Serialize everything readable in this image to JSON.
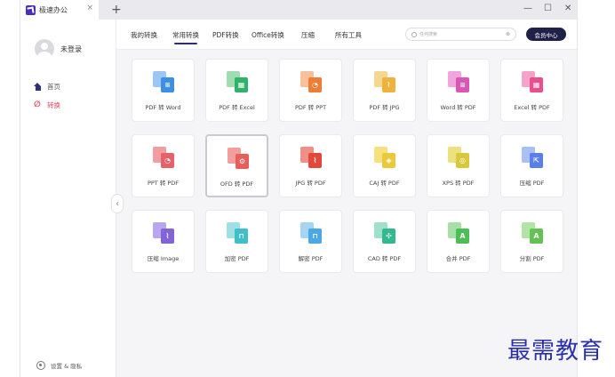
{
  "window": {
    "tab_title": "极速办公",
    "tab_close": "×",
    "new_tab": "+",
    "controls": {
      "minimize": "—",
      "maximize": "☐",
      "close": "✕"
    }
  },
  "sidebar": {
    "user_label": "未登录",
    "nav": [
      {
        "label": "首页",
        "icon": "home-icon"
      },
      {
        "label": "转换",
        "icon": "convert-icon"
      }
    ],
    "settings_label": "设置 & 隐私",
    "collapse_glyph": "‹"
  },
  "topnav": {
    "tabs": [
      {
        "label": "我的转换"
      },
      {
        "label": "常用转换"
      },
      {
        "label": "PDF转换"
      },
      {
        "label": "Office转换"
      },
      {
        "label": "压缩"
      },
      {
        "label": "所有工具"
      }
    ],
    "active_tab": 1,
    "search_placeholder": "任何搜索",
    "search_clear": "⊗",
    "vip_label": "会员中心"
  },
  "tools": [
    {
      "label": "PDF 转 Word",
      "back": "#9dc6f3",
      "front": "#3d8fe6",
      "glyph": "≡"
    },
    {
      "label": "PDF 转 Excel",
      "back": "#9fdcaf",
      "front": "#2fb36a",
      "glyph": "▦"
    },
    {
      "label": "PDF 转 PPT",
      "back": "#f6c19b",
      "front": "#ef7d35",
      "glyph": "◔"
    },
    {
      "label": "PDF 转 JPG",
      "back": "#f6d791",
      "front": "#efb23c",
      "glyph": "⌇"
    },
    {
      "label": "Word 转 PDF",
      "back": "#f0a5dc",
      "front": "#db55b6",
      "glyph": "≡"
    },
    {
      "label": "Excel 转 PDF",
      "back": "#f5a3c8",
      "front": "#e94f8f",
      "glyph": "▦"
    },
    {
      "label": "PPT 转 PDF",
      "back": "#f19ea2",
      "front": "#e8606a",
      "glyph": "◔"
    },
    {
      "label": "OFD 转 PDF",
      "back": "#f29e9c",
      "front": "#e65f5b",
      "glyph": "⚙"
    },
    {
      "label": "JPG 转 PDF",
      "back": "#ef8f86",
      "front": "#e2493b",
      "glyph": "⌇"
    },
    {
      "label": "CAJ 转 PDF",
      "back": "#f5e27d",
      "front": "#eac93a",
      "glyph": "◈"
    },
    {
      "label": "XPS 转 PDF",
      "back": "#ece07f",
      "front": "#d8c83a",
      "glyph": "◎"
    },
    {
      "label": "压缩 PDF",
      "back": "#a9bff6",
      "front": "#5a7fe8",
      "glyph": "⇱"
    },
    {
      "label": "压缩 Image",
      "back": "#b9a6ee",
      "front": "#8363d8",
      "glyph": "⌇"
    },
    {
      "label": "加密 PDF",
      "back": "#9fe0e5",
      "front": "#3fbfc9",
      "glyph": "⊓"
    },
    {
      "label": "解密 PDF",
      "back": "#a6d5f3",
      "front": "#4aa8e5",
      "glyph": "⊓"
    },
    {
      "label": "CAD 转 PDF",
      "back": "#9ee0c9",
      "front": "#32b98d",
      "glyph": "✣"
    },
    {
      "label": "合并 PDF",
      "back": "#a6e0a6",
      "front": "#4dbd55",
      "glyph": "A"
    },
    {
      "label": "分割 PDF",
      "back": "#b4e3a7",
      "front": "#62c352",
      "glyph": "A"
    }
  ],
  "highlighted_tool": 7,
  "watermark": "最需教育"
}
